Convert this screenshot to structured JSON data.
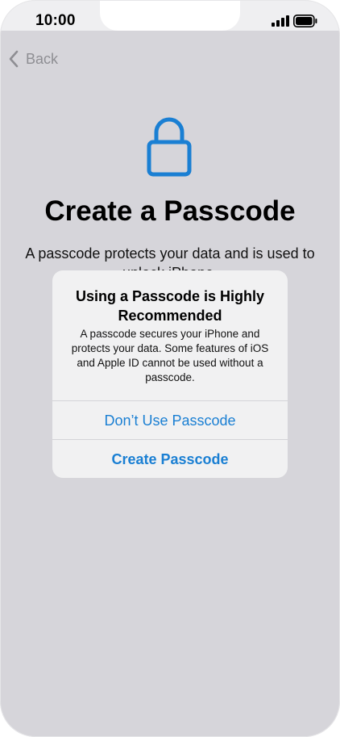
{
  "status_bar": {
    "time": "10:00",
    "signal_icon": "cellular-signal-icon",
    "battery_icon": "battery-icon"
  },
  "nav": {
    "back_label": "Back",
    "back_icon": "chevron-left-icon"
  },
  "hero": {
    "icon": "lock-icon",
    "title": "Create a Passcode",
    "subtitle": "A passcode protects your data and is used to unlock iPhone."
  },
  "alert": {
    "title": "Using a Passcode is Highly Recommended",
    "message": "A passcode secures your iPhone and protects your data. Some features of iOS and Apple ID cannot be used without a passcode.",
    "buttons": [
      {
        "label": "Don’t Use Passcode"
      },
      {
        "label": "Create Passcode"
      }
    ]
  },
  "colors": {
    "accent": "#1a7fd3",
    "background": "#d6d5da",
    "alert_background": "#f1f1f2"
  }
}
